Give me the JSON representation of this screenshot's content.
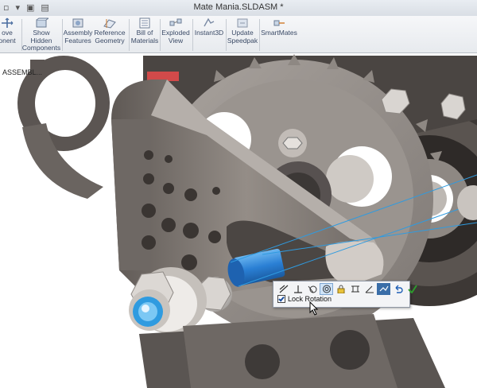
{
  "window": {
    "title": "Mate Mania.SLDASM *"
  },
  "ribbon": {
    "items": [
      {
        "label": "ove\nonent",
        "icon": "move-component-icon"
      },
      {
        "label": "Show\nHidden\nComponents",
        "icon": "show-hidden-icon"
      },
      {
        "label": "Assembly\nFeatures",
        "icon": "assembly-features-icon"
      },
      {
        "label": "Reference\nGeometry",
        "icon": "reference-geometry-icon"
      },
      {
        "label": "Bill of\nMaterials",
        "icon": "bill-of-materials-icon"
      },
      {
        "label": "Exploded\nView",
        "icon": "exploded-view-icon"
      },
      {
        "label": "Instant3D",
        "icon": "instant3d-icon"
      },
      {
        "label": "Update\nSpeedpak",
        "icon": "update-speedpak-icon"
      },
      {
        "label": "SmartMates",
        "icon": "smartmates-icon"
      }
    ]
  },
  "tree": {
    "label": "ASSEMBL..."
  },
  "mate_toolbar": {
    "buttons": [
      "coincident-mate-icon",
      "perpendicular-mate-icon",
      "tangent-mate-icon",
      "concentric-mate-icon",
      "lock-mate-icon",
      "width-mate-icon",
      "angle-mate-icon",
      "flip-alignment-icon",
      "undo-icon",
      "accept-check-icon"
    ],
    "active_button": "concentric-mate-icon",
    "lock_rotation_label": "Lock Rotation",
    "lock_rotation_checked": true
  },
  "colors": {
    "accent": "#2f9be0",
    "metal": "#8a8480",
    "selected_face": "#2a7fd4"
  }
}
